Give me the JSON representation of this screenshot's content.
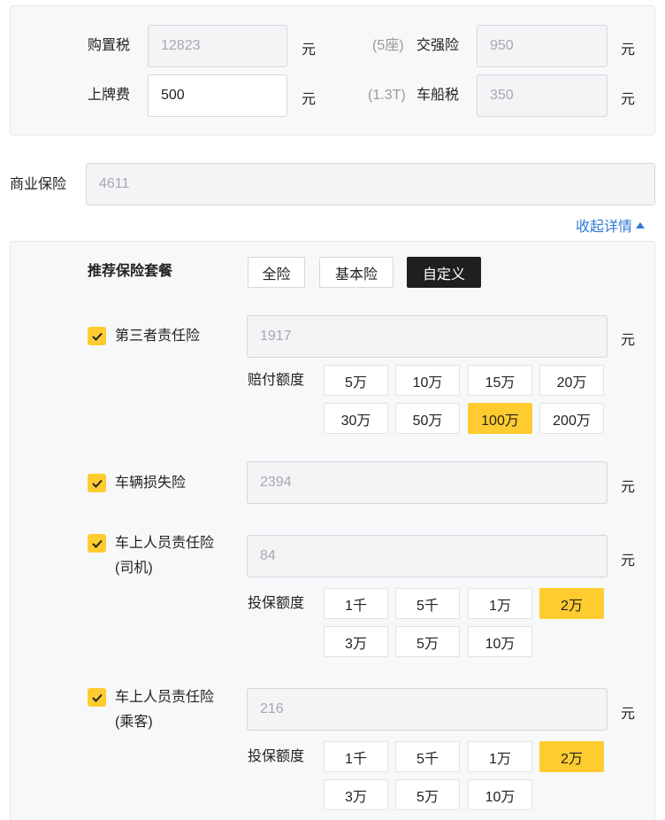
{
  "fees": {
    "purchase_tax": {
      "label": "购置税",
      "value": "12823",
      "unit": "元"
    },
    "plate_fee": {
      "label": "上牌费",
      "value": "500",
      "unit": "元"
    },
    "compulsory": {
      "hint": "(5座)",
      "label": "交强险",
      "value": "950",
      "unit": "元"
    },
    "vessel_tax": {
      "hint": "(1.3T)",
      "label": "车船税",
      "value": "350",
      "unit": "元"
    }
  },
  "commercial": {
    "label": "商业保险",
    "value": "4611"
  },
  "collapse_link": "收起详情",
  "package": {
    "label": "推荐保险套餐",
    "options": [
      "全险",
      "基本险",
      "自定义"
    ],
    "selected": "自定义"
  },
  "insurances": [
    {
      "title": "第三者责任险",
      "value": "1917",
      "unit": "元",
      "checked": true,
      "option_label": "赔付额度",
      "options": [
        "5万",
        "10万",
        "15万",
        "20万",
        "30万",
        "50万",
        "100万",
        "200万"
      ],
      "selected": "100万"
    },
    {
      "title": "车辆损失险",
      "value": "2394",
      "unit": "元",
      "checked": true
    },
    {
      "title": "车上人员责任险",
      "subtitle": "(司机)",
      "value": "84",
      "unit": "元",
      "checked": true,
      "option_label": "投保额度",
      "options": [
        "1千",
        "5千",
        "1万",
        "2万",
        "3万",
        "5万",
        "10万"
      ],
      "selected": "2万"
    },
    {
      "title": "车上人员责任险",
      "subtitle": "(乘客)",
      "value": "216",
      "unit": "元",
      "checked": true,
      "option_label": "投保额度",
      "options": [
        "1千",
        "5千",
        "1万",
        "2万",
        "3万",
        "5万",
        "10万"
      ],
      "selected": "2万"
    }
  ]
}
